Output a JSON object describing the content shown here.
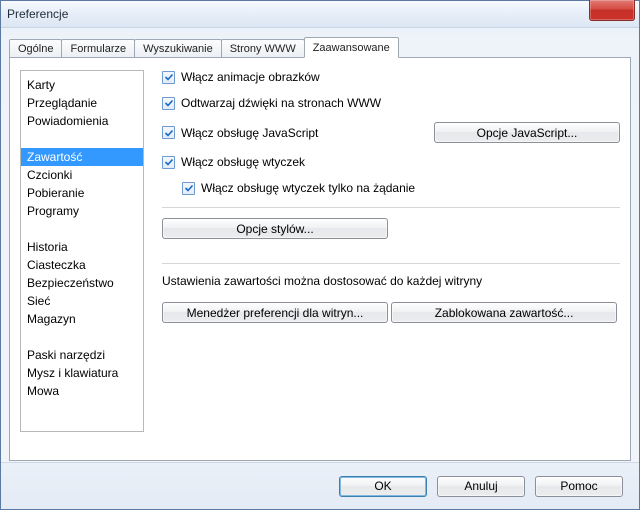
{
  "window": {
    "title": "Preferencje"
  },
  "tabs": {
    "general": "Ogólne",
    "forms": "Formularze",
    "search": "Wyszukiwanie",
    "pages": "Strony WWW",
    "advanced": "Zaawansowane"
  },
  "sidebar": {
    "g1": {
      "cards": "Karty",
      "browsing": "Przeglądanie",
      "notifications": "Powiadomienia"
    },
    "g2": {
      "content": "Zawartość",
      "fonts": "Czcionki",
      "download": "Pobieranie",
      "programs": "Programy"
    },
    "g3": {
      "history": "Historia",
      "cookies": "Ciasteczka",
      "security": "Bezpieczeństwo",
      "network": "Sieć",
      "storage": "Magazyn"
    },
    "g4": {
      "toolbars": "Paski narzędzi",
      "mouse": "Mysz i klawiatura",
      "speech": "Mowa"
    }
  },
  "options": {
    "anim": "Włącz animacje obrazków",
    "sound": "Odtwarzaj dźwięki na stronach WWW",
    "js": "Włącz obsługę JavaScript",
    "jsopt": "Opcje JavaScript...",
    "plugins": "Włącz obsługę wtyczek",
    "plugins_ondemand": "Włącz obsługę wtyczek tylko na żądanie",
    "styleopt": "Opcje stylów...",
    "site_note": "Ustawienia zawartości można dostosować do każdej witryny",
    "site_mgr": "Menedżer preferencji dla witryn...",
    "blocked": "Zablokowana zawartość..."
  },
  "footer": {
    "ok": "OK",
    "cancel": "Anuluj",
    "help": "Pomoc"
  }
}
